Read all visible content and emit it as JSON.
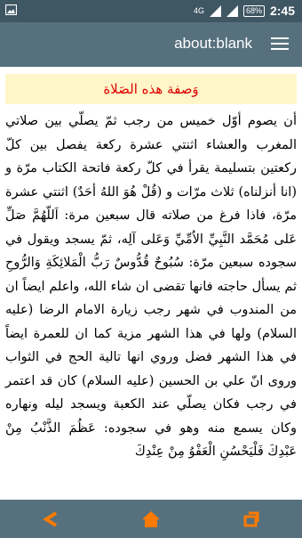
{
  "status_bar": {
    "network": "4G",
    "battery": "68%",
    "time": "2:45"
  },
  "toolbar": {
    "title": "about:blank",
    "menu_icon": "hamburger-menu-icon"
  },
  "article": {
    "heading": "وَصفة هذه الصَلاة",
    "body": "أن يصوم أوّل خميس من رجب ثمّ يصلّي بين صلاتي المغرب والعشاء اثنتي عشرة ركعة يفصل بين كلّ ركعتين بتسليمة يقرأ في كلّ ركعة فاتحة الكتاب مرّة و (انا أنزلناه) ثلاث مرّات و (قُلْ هُوَ اللهُ أحَدٌ) اثنتي عشرة مرّة، فاذا فرغ من صلاته قال سبعين مرة: اَللّهُمَّ صَلِّ عَلى مُحَمَّد النَّبِيِّ الاُمِّيِّ وَعَلى آلِه، ثمّ يسجد ويقول في سجوده سبعين مرّة: سُبُوحٌ قُدُّوسٌ رَبُّ الْمَلائِكَةِ وَالرُّوحِ ثم يسأل حاجته فانها تقضى ان شاء الله، واعلم ايضاً ان من المندوب في شهر رجب زيارة الامام الرضا (عليه السلام) ولها في هذا الشهر مزية كما ان للعمرة ايضاً في هذا الشهر فضل وروي انها تالية الحج في الثواب وروى انّ علي بن الحسين (عليه السلام) كان قد اعتمر في رجب فكان يصلّي عند الكعبة ويسجد ليله ونهاره وكان يسمع منه وهو في سجوده: عَظُمَ الذَّنْبُ مِنْ عَبْدِكَ فَلْيَحْسُنِ الْعَفْوُ مِنْ عِنْدِكَ"
  },
  "nav_bar": {
    "back_icon": "back-arrow-icon",
    "home_icon": "home-icon",
    "recent_icon": "recent-apps-icon",
    "accent_color": "#ff7a00"
  },
  "colors": {
    "status_bar": "#3f5663",
    "toolbar": "#56717d",
    "heading_bg": "#fef6c8",
    "heading_text": "#e00000"
  }
}
